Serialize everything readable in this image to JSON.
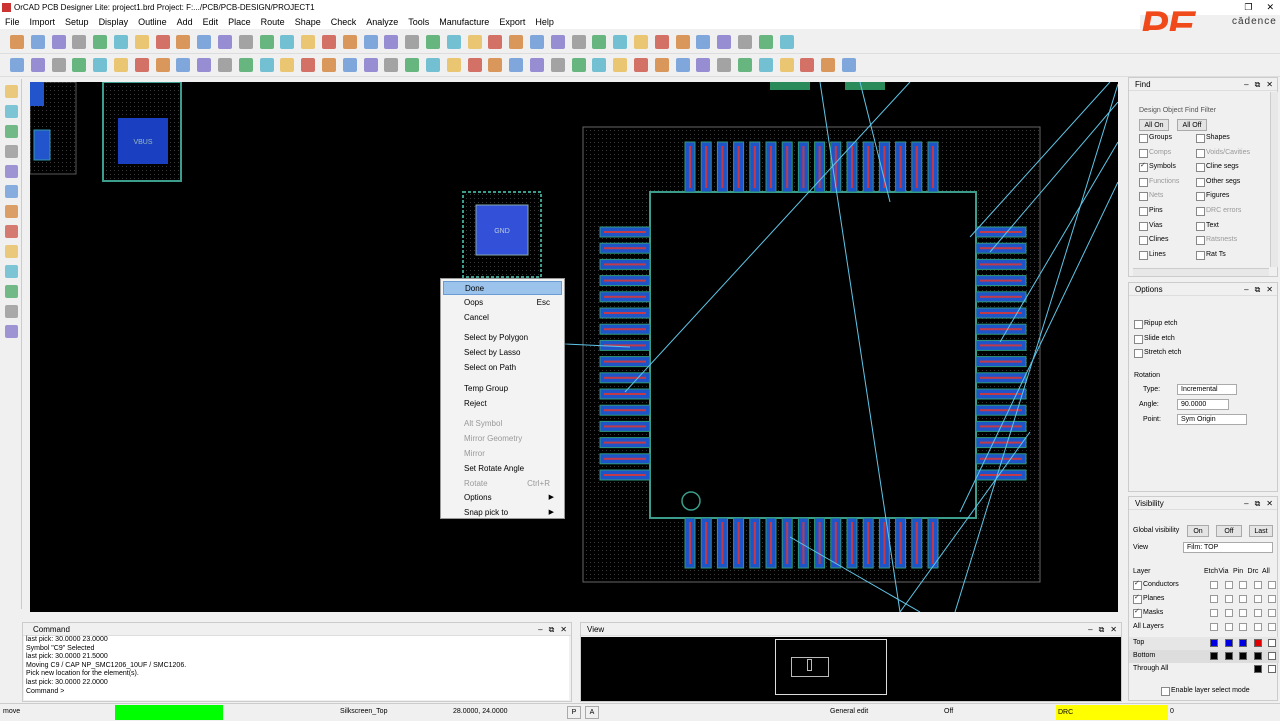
{
  "app": {
    "title": "OrCAD PCB Designer Lite: project1.brd  Project: F:.../PCB/PCB-DESIGN/PROJECT1"
  },
  "brand": {
    "pe": "PE",
    "cadence": "cādence",
    "accent": "#f04a1a"
  },
  "menu": [
    "File",
    "Import",
    "Setup",
    "Display",
    "Outline",
    "Add",
    "Edit",
    "Place",
    "Route",
    "Shape",
    "Check",
    "Analyze",
    "Tools",
    "Manufacture",
    "Export",
    "Help"
  ],
  "canvas": {
    "vbus_label": "VBUS",
    "gnd_label": "GND"
  },
  "context_menu": {
    "items": [
      {
        "label": "Done",
        "shortcut": "",
        "highlighted": true
      },
      {
        "label": "Oops",
        "shortcut": "Esc"
      },
      {
        "label": "Cancel",
        "shortcut": ""
      },
      {
        "label": "Select by Polygon",
        "shortcut": ""
      },
      {
        "label": "Select by Lasso",
        "shortcut": ""
      },
      {
        "label": "Select on Path",
        "shortcut": ""
      },
      {
        "label": "Temp Group",
        "shortcut": ""
      },
      {
        "label": "Reject",
        "shortcut": ""
      },
      {
        "label": "Alt Symbol",
        "shortcut": "",
        "disabled": true
      },
      {
        "label": "Mirror Geometry",
        "shortcut": "",
        "disabled": true
      },
      {
        "label": "Mirror",
        "shortcut": "",
        "disabled": true
      },
      {
        "label": "Set Rotate Angle",
        "shortcut": ""
      },
      {
        "label": "Rotate",
        "shortcut": "Ctrl+R",
        "disabled": true
      },
      {
        "label": "Options",
        "shortcut": "",
        "submenu": true
      },
      {
        "label": "Snap pick to",
        "shortcut": "",
        "submenu": true
      }
    ]
  },
  "find": {
    "title": "Find",
    "filter_title": "Design Object Find Filter",
    "all_on": "All On",
    "all_off": "All Off",
    "left": [
      {
        "label": "Groups",
        "checked": false
      },
      {
        "label": "Comps",
        "checked": false,
        "disabled": true
      },
      {
        "label": "Symbols",
        "checked": true
      },
      {
        "label": "Functions",
        "checked": false,
        "disabled": true
      },
      {
        "label": "Nets",
        "checked": false,
        "disabled": true
      },
      {
        "label": "Pins",
        "checked": false
      },
      {
        "label": "Vias",
        "checked": false
      },
      {
        "label": "Clines",
        "checked": false
      },
      {
        "label": "Lines",
        "checked": false
      }
    ],
    "right": [
      {
        "label": "Shapes",
        "checked": false
      },
      {
        "label": "Voids/Cavities",
        "checked": false,
        "disabled": true
      },
      {
        "label": "Cline segs",
        "checked": false
      },
      {
        "label": "Other segs",
        "checked": false
      },
      {
        "label": "Figures",
        "checked": false
      },
      {
        "label": "DRC errors",
        "checked": false,
        "disabled": true
      },
      {
        "label": "Text",
        "checked": false
      },
      {
        "label": "Ratsnests",
        "checked": false,
        "disabled": true
      },
      {
        "label": "Rat Ts",
        "checked": false
      }
    ]
  },
  "options": {
    "title": "Options",
    "ripup": "Ripup etch",
    "slide": "Slide etch",
    "stretch": "Stretch etch",
    "rotation": "Rotation",
    "type_label": "Type:",
    "type_value": "Incremental",
    "angle_label": "Angle:",
    "angle_value": "90.0000",
    "point_label": "Point:",
    "point_value": "Sym Origin"
  },
  "visibility": {
    "title": "Visibility",
    "global": "Global visibility",
    "on": "On",
    "off": "Off",
    "last": "Last",
    "view_label": "View",
    "view_value": "Film: TOP",
    "layer_hdr": "Layer",
    "cols": [
      "Etch",
      "Via",
      "Pin",
      "Drc",
      "All"
    ],
    "layers": [
      {
        "label": "Conductors",
        "checked": true
      },
      {
        "label": "Planes",
        "checked": true
      },
      {
        "label": "Masks",
        "checked": true
      },
      {
        "label": "All Layers",
        "checked": false
      }
    ],
    "top": "Top",
    "bottom": "Bottom",
    "through": "Through All",
    "enable_select": "Enable layer select mode"
  },
  "command": {
    "title": "Command",
    "log": [
      "last pick:  30.0000 23.0000",
      "Symbol \"C9\" Selected",
      "last pick:  30.0000 21.5000",
      "Moving C9 / CAP NP_SMC1206_10UF / SMC1206.",
      "Pick new location for the element(s).",
      "last pick:  30.0000 22.0000",
      "Command >"
    ]
  },
  "view_panel": {
    "title": "View"
  },
  "status": {
    "mode": "move",
    "layer": "Silkscreen_Top",
    "coords": "28.0000, 24.0000",
    "p": "P",
    "a": "A",
    "edit_mode": "General edit",
    "off": "Off",
    "drc": "DRC",
    "drc_count": "0",
    "drc_color": "#ffff00",
    "busy_color": "#00ff00"
  }
}
